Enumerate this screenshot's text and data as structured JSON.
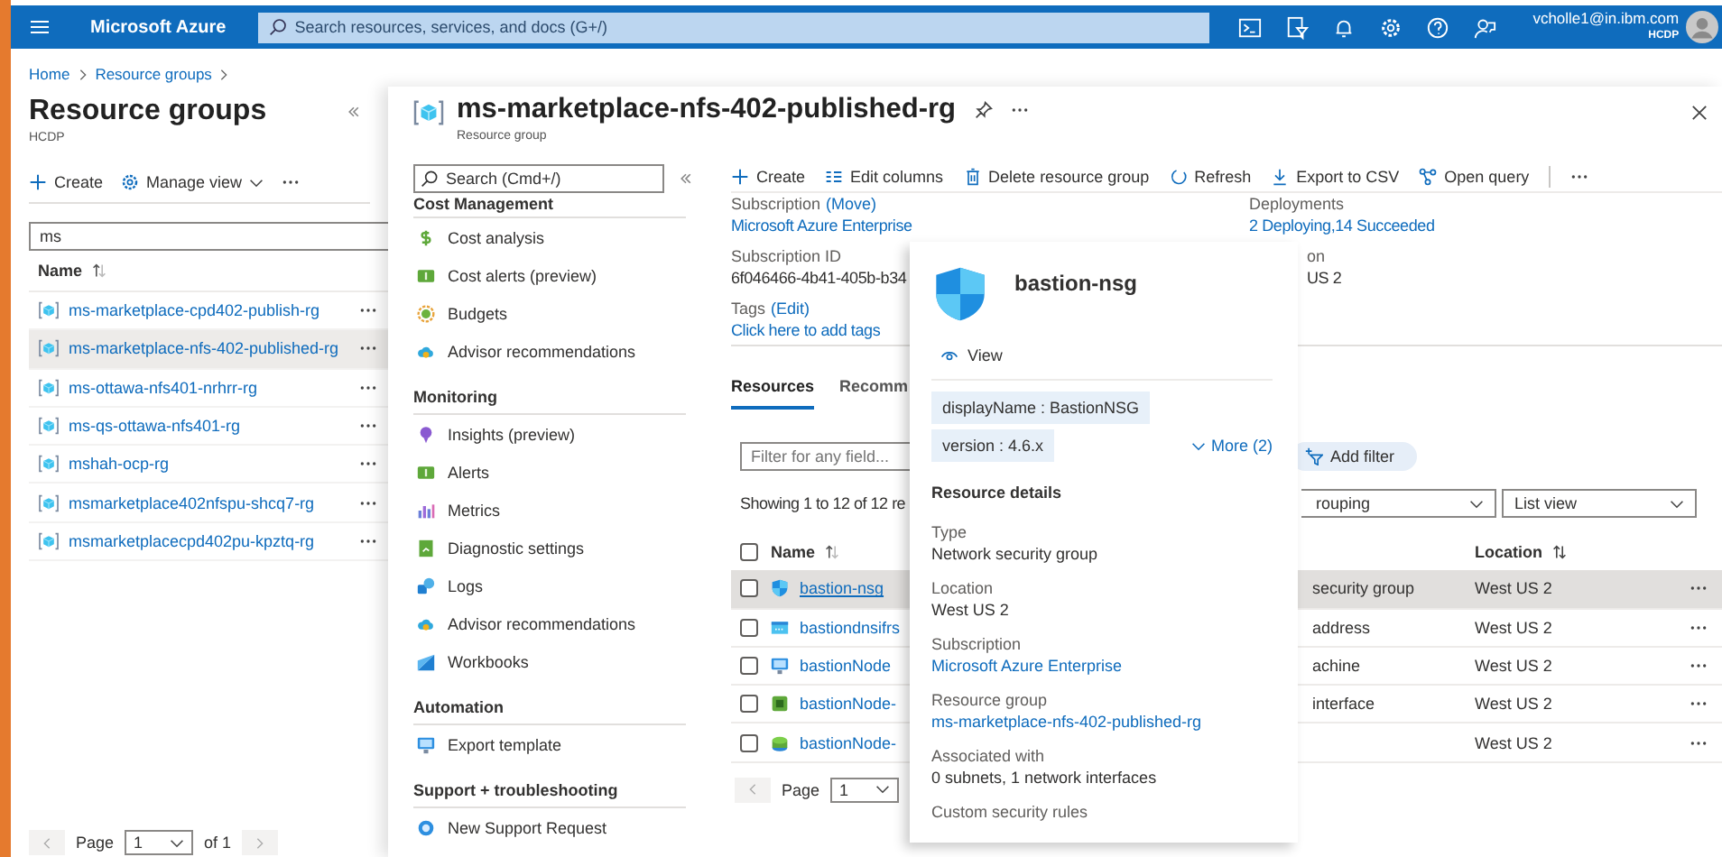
{
  "header": {
    "brand": "Microsoft Azure",
    "search_placeholder": "Search resources, services, and docs (G+/)",
    "account": "vcholle1@in.ibm.com",
    "tenant": "HCDP"
  },
  "breadcrumb": [
    "Home",
    "Resource groups"
  ],
  "left_pane": {
    "title": "Resource groups",
    "subtitle": "HCDP",
    "toolbar": [
      "Create",
      "Manage view"
    ],
    "filter_value": "ms",
    "column": "Name",
    "rows": [
      {
        "name": "ms-marketplace-cpd402-publish-rg",
        "selected": false
      },
      {
        "name": "ms-marketplace-nfs-402-published-rg",
        "selected": true
      },
      {
        "name": "ms-ottawa-nfs401-nrhrr-rg",
        "selected": false
      },
      {
        "name": "ms-qs-ottawa-nfs401-rg",
        "selected": false
      },
      {
        "name": "mshah-ocp-rg",
        "selected": false
      },
      {
        "name": "msmarketplace402nfspu-shcq7-rg",
        "selected": false
      },
      {
        "name": "msmarketplacecpd402pu-kpztq-rg",
        "selected": false
      }
    ],
    "pagination": {
      "label": "Page",
      "page": "1",
      "total": "of 1"
    }
  },
  "blade": {
    "title": "ms-marketplace-nfs-402-published-rg",
    "subtitle": "Resource group",
    "menu_search_placeholder": "Search (Cmd+/)",
    "menu": [
      {
        "kind": "header",
        "label": "Cost Management"
      },
      {
        "kind": "item",
        "label": "Cost analysis"
      },
      {
        "kind": "item",
        "label": "Cost alerts (preview)"
      },
      {
        "kind": "item",
        "label": "Budgets"
      },
      {
        "kind": "item",
        "label": "Advisor recommendations"
      },
      {
        "kind": "header",
        "label": "Monitoring"
      },
      {
        "kind": "item",
        "label": "Insights (preview)"
      },
      {
        "kind": "item",
        "label": "Alerts"
      },
      {
        "kind": "item",
        "label": "Metrics"
      },
      {
        "kind": "item",
        "label": "Diagnostic settings"
      },
      {
        "kind": "item",
        "label": "Logs"
      },
      {
        "kind": "item",
        "label": "Advisor recommendations"
      },
      {
        "kind": "item",
        "label": "Workbooks"
      },
      {
        "kind": "header",
        "label": "Automation"
      },
      {
        "kind": "item",
        "label": "Export template"
      },
      {
        "kind": "header",
        "label": "Support + troubleshooting"
      },
      {
        "kind": "item",
        "label": "New Support Request"
      }
    ],
    "toolbar": [
      "Create",
      "Edit columns",
      "Delete resource group",
      "Refresh",
      "Export to CSV",
      "Open query"
    ],
    "essentials_left": [
      {
        "label": "Subscription",
        "action": "(Move)",
        "value": "Microsoft Azure Enterprise",
        "value_link": true
      },
      {
        "label": "Subscription ID",
        "value": "6f046466-4b41-405b-b34",
        "value_link": false
      },
      {
        "label": "Tags",
        "action": "(Edit)",
        "value": "Click here to add tags",
        "value_link": true
      }
    ],
    "essentials_right": [
      {
        "label": "Deployments",
        "value": "2 Deploying,14 Succeeded",
        "value_link": true
      },
      {
        "label": "on",
        "value": "US 2",
        "value_link": false
      }
    ],
    "tabs": [
      {
        "label": "Resources",
        "selected": true
      },
      {
        "label": "Recomm",
        "selected": false
      }
    ],
    "filter_placeholder": "Filter for any field...",
    "add_filter": "Add filter",
    "showing": "Showing 1 to 12 of 12 re",
    "dropdowns": [
      "rouping",
      "List view"
    ],
    "columns": [
      "Name",
      "Location"
    ],
    "all_checked": false,
    "rows": [
      {
        "name": "bastion-nsg",
        "type": "security group",
        "location": "West US 2",
        "highlighted": true,
        "checked": false
      },
      {
        "name": "bastiondnsifrs",
        "type": "address",
        "location": "West US 2",
        "highlighted": false,
        "checked": false
      },
      {
        "name": "bastionNode",
        "type": "achine",
        "location": "West US 2",
        "highlighted": false,
        "checked": false
      },
      {
        "name": "bastionNode-",
        "type": "interface",
        "location": "West US 2",
        "highlighted": false,
        "checked": false
      },
      {
        "name": "bastionNode-",
        "location": "West US 2",
        "highlighted": false,
        "checked": false
      }
    ],
    "pagination": {
      "label": "Page",
      "page": "1"
    }
  },
  "popup": {
    "title": "bastion-nsg",
    "action": "View",
    "tags": [
      "displayName : BastionNSG",
      "version : 4.6.x"
    ],
    "more": "More (2)",
    "section": "Resource details",
    "details": [
      {
        "label": "Type",
        "value": "Network security group",
        "link": false
      },
      {
        "label": "Location",
        "value": "West US 2",
        "link": false
      },
      {
        "label": "Subscription",
        "value": "Microsoft Azure Enterprise",
        "link": true
      },
      {
        "label": "Resource group",
        "value": "ms-marketplace-nfs-402-published-rg",
        "link": true
      },
      {
        "label": "Associated with",
        "value": "0 subnets, 1 network interfaces",
        "link": false
      },
      {
        "label": "Custom security rules"
      }
    ]
  }
}
